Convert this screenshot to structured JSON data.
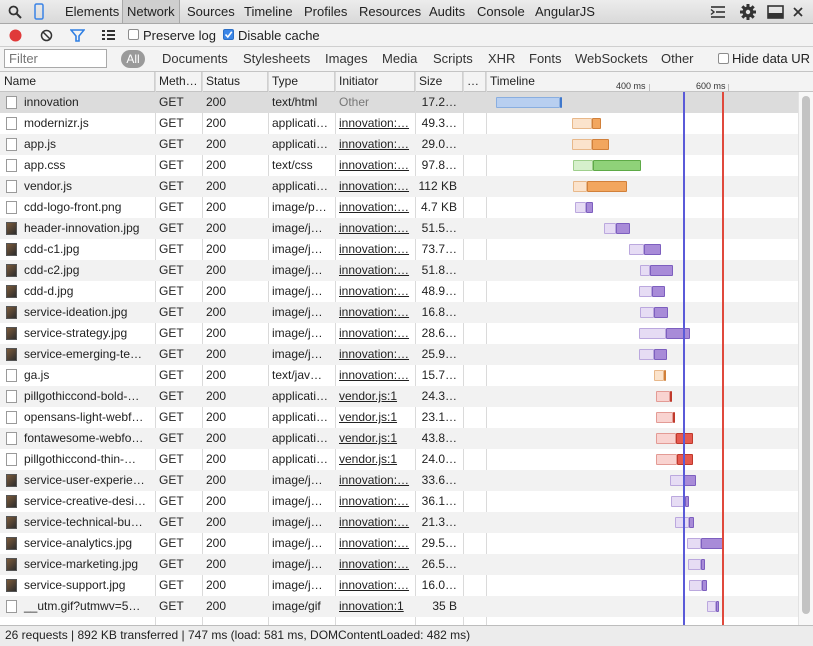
{
  "toolbar": {
    "tabs": [
      "Elements",
      "Network",
      "Sources",
      "Timeline",
      "Profiles",
      "Resources",
      "Audits",
      "Console",
      "AngularJS"
    ],
    "active_tab": "Network"
  },
  "filter": {
    "preserve_log": "Preserve log",
    "disable_cache": "Disable cache",
    "placeholder": "Filter",
    "types": [
      "All",
      "Documents",
      "Stylesheets",
      "Images",
      "Media",
      "Scripts",
      "XHR",
      "Fonts",
      "WebSockets",
      "Other"
    ],
    "hide_data": "Hide data UR"
  },
  "columns": [
    "Name",
    "Meth…",
    "Status",
    "Type",
    "Initiator",
    "Size",
    "…",
    "Timeline"
  ],
  "timeline_ticks": [
    "400 ms",
    "600 ms"
  ],
  "rows": [
    {
      "name": "innovation",
      "method": "GET",
      "status": "200",
      "type": "text/html",
      "initiator": "Other",
      "size": "17.2…",
      "icon": "doc",
      "bars": [
        [
          496,
          560,
          "#b8cff0",
          "#89aee0"
        ],
        [
          560,
          562,
          "#3f78cc",
          "#3f78cc"
        ]
      ]
    },
    {
      "name": "modernizr.js",
      "method": "GET",
      "status": "200",
      "type": "applicati…",
      "initiator": "innovation:…",
      "size": "49.3…",
      "icon": "doc",
      "bars": [
        [
          572,
          592,
          "#fbe3cc",
          "#e8b88a"
        ],
        [
          592,
          601,
          "#f2a65e",
          "#d1803a"
        ]
      ]
    },
    {
      "name": "app.js",
      "method": "GET",
      "status": "200",
      "type": "applicati…",
      "initiator": "innovation:…",
      "size": "29.0…",
      "icon": "doc",
      "bars": [
        [
          572,
          592,
          "#fbe3cc",
          "#e8b88a"
        ],
        [
          592,
          609,
          "#f2a65e",
          "#d1803a"
        ]
      ]
    },
    {
      "name": "app.css",
      "method": "GET",
      "status": "200",
      "type": "text/css",
      "initiator": "innovation:…",
      "size": "97.8…",
      "icon": "doc",
      "bars": [
        [
          573,
          593,
          "#d6f0cc",
          "#9fcf8d"
        ],
        [
          593,
          641,
          "#8fd279",
          "#5eaa47"
        ]
      ]
    },
    {
      "name": "vendor.js",
      "method": "GET",
      "status": "200",
      "type": "applicati…",
      "initiator": "innovation:…",
      "size": "112 KB",
      "icon": "doc",
      "bars": [
        [
          573,
          587,
          "#fbe3cc",
          "#e8b88a"
        ],
        [
          587,
          627,
          "#f2a65e",
          "#d1803a"
        ]
      ]
    },
    {
      "name": "cdd-logo-front.png",
      "method": "GET",
      "status": "200",
      "type": "image/p…",
      "initiator": "innovation:…",
      "size": "4.7 KB",
      "icon": "doc",
      "bars": [
        [
          575,
          586,
          "#e6dcf4",
          "#bba8de"
        ],
        [
          586,
          593,
          "#a88bd8",
          "#7d5fbf"
        ]
      ]
    },
    {
      "name": "header-innovation.jpg",
      "method": "GET",
      "status": "200",
      "type": "image/j…",
      "initiator": "innovation:…",
      "size": "51.5…",
      "icon": "img",
      "bars": [
        [
          604,
          616,
          "#e6dcf4",
          "#bba8de"
        ],
        [
          616,
          630,
          "#a88bd8",
          "#7d5fbf"
        ]
      ]
    },
    {
      "name": "cdd-c1.jpg",
      "method": "GET",
      "status": "200",
      "type": "image/j…",
      "initiator": "innovation:…",
      "size": "73.7…",
      "icon": "img",
      "bars": [
        [
          629,
          644,
          "#e6dcf4",
          "#bba8de"
        ],
        [
          644,
          661,
          "#a88bd8",
          "#7d5fbf"
        ]
      ]
    },
    {
      "name": "cdd-c2.jpg",
      "method": "GET",
      "status": "200",
      "type": "image/j…",
      "initiator": "innovation:…",
      "size": "51.8…",
      "icon": "img",
      "bars": [
        [
          640,
          650,
          "#e6dcf4",
          "#bba8de"
        ],
        [
          650,
          673,
          "#a88bd8",
          "#7d5fbf"
        ]
      ]
    },
    {
      "name": "cdd-d.jpg",
      "method": "GET",
      "status": "200",
      "type": "image/j…",
      "initiator": "innovation:…",
      "size": "48.9…",
      "icon": "img",
      "bars": [
        [
          639,
          652,
          "#e6dcf4",
          "#bba8de"
        ],
        [
          652,
          665,
          "#a88bd8",
          "#7d5fbf"
        ]
      ]
    },
    {
      "name": "service-ideation.jpg",
      "method": "GET",
      "status": "200",
      "type": "image/j…",
      "initiator": "innovation:…",
      "size": "16.8…",
      "icon": "img",
      "bars": [
        [
          640,
          654,
          "#e6dcf4",
          "#bba8de"
        ],
        [
          654,
          668,
          "#a88bd8",
          "#7d5fbf"
        ]
      ]
    },
    {
      "name": "service-strategy.jpg",
      "method": "GET",
      "status": "200",
      "type": "image/j…",
      "initiator": "innovation:…",
      "size": "28.6…",
      "icon": "img",
      "bars": [
        [
          639,
          666,
          "#e6dcf4",
          "#bba8de"
        ],
        [
          666,
          690,
          "#a88bd8",
          "#7d5fbf"
        ]
      ]
    },
    {
      "name": "service-emerging-te…",
      "method": "GET",
      "status": "200",
      "type": "image/j…",
      "initiator": "innovation:…",
      "size": "25.9…",
      "icon": "img",
      "bars": [
        [
          639,
          654,
          "#e6dcf4",
          "#bba8de"
        ],
        [
          654,
          667,
          "#a88bd8",
          "#7d5fbf"
        ]
      ]
    },
    {
      "name": "ga.js",
      "method": "GET",
      "status": "200",
      "type": "text/jav…",
      "initiator": "innovation:…",
      "size": "15.7…",
      "icon": "doc",
      "bars": [
        [
          654,
          664,
          "#fbe3cc",
          "#e8b88a"
        ],
        [
          664,
          666,
          "#f2a65e",
          "#d1803a"
        ]
      ]
    },
    {
      "name": "pillgothiccond-bold-…",
      "method": "GET",
      "status": "200",
      "type": "applicati…",
      "initiator": "vendor.js:1",
      "size": "24.3…",
      "icon": "doc",
      "bars": [
        [
          656,
          670,
          "#f9d3d0",
          "#e39b95"
        ],
        [
          670,
          672,
          "#e55a50",
          "#c0392b"
        ]
      ]
    },
    {
      "name": "opensans-light-webf…",
      "method": "GET",
      "status": "200",
      "type": "applicati…",
      "initiator": "vendor.js:1",
      "size": "23.1…",
      "icon": "doc",
      "bars": [
        [
          656,
          673,
          "#f9d3d0",
          "#e39b95"
        ],
        [
          673,
          675,
          "#e55a50",
          "#c0392b"
        ]
      ]
    },
    {
      "name": "fontawesome-webfo…",
      "method": "GET",
      "status": "200",
      "type": "applicati…",
      "initiator": "vendor.js:1",
      "size": "43.8…",
      "icon": "doc",
      "bars": [
        [
          656,
          676,
          "#f9d3d0",
          "#e39b95"
        ],
        [
          676,
          693,
          "#e55a50",
          "#c0392b"
        ]
      ]
    },
    {
      "name": "pillgothiccond-thin-…",
      "method": "GET",
      "status": "200",
      "type": "applicati…",
      "initiator": "vendor.js:1",
      "size": "24.0…",
      "icon": "doc",
      "bars": [
        [
          656,
          677,
          "#f9d3d0",
          "#e39b95"
        ],
        [
          677,
          693,
          "#e55a50",
          "#c0392b"
        ]
      ]
    },
    {
      "name": "service-user-experie…",
      "method": "GET",
      "status": "200",
      "type": "image/j…",
      "initiator": "innovation:…",
      "size": "33.6…",
      "icon": "img",
      "bars": [
        [
          670,
          684,
          "#e6dcf4",
          "#bba8de"
        ],
        [
          684,
          696,
          "#a88bd8",
          "#7d5fbf"
        ]
      ]
    },
    {
      "name": "service-creative-desi…",
      "method": "GET",
      "status": "200",
      "type": "image/j…",
      "initiator": "innovation:…",
      "size": "36.1…",
      "icon": "img",
      "bars": [
        [
          671,
          685,
          "#e6dcf4",
          "#bba8de"
        ],
        [
          685,
          689,
          "#a88bd8",
          "#7d5fbf"
        ]
      ]
    },
    {
      "name": "service-technical-bu…",
      "method": "GET",
      "status": "200",
      "type": "image/j…",
      "initiator": "innovation:…",
      "size": "21.3…",
      "icon": "img",
      "bars": [
        [
          675,
          689,
          "#e6dcf4",
          "#bba8de"
        ],
        [
          689,
          694,
          "#a88bd8",
          "#7d5fbf"
        ]
      ]
    },
    {
      "name": "service-analytics.jpg",
      "method": "GET",
      "status": "200",
      "type": "image/j…",
      "initiator": "innovation:…",
      "size": "29.5…",
      "icon": "img",
      "bars": [
        [
          687,
          701,
          "#e6dcf4",
          "#bba8de"
        ],
        [
          701,
          723,
          "#a88bd8",
          "#7d5fbf"
        ]
      ]
    },
    {
      "name": "service-marketing.jpg",
      "method": "GET",
      "status": "200",
      "type": "image/j…",
      "initiator": "innovation:…",
      "size": "26.5…",
      "icon": "img",
      "bars": [
        [
          688,
          701,
          "#e6dcf4",
          "#bba8de"
        ],
        [
          701,
          705,
          "#a88bd8",
          "#7d5fbf"
        ]
      ]
    },
    {
      "name": "service-support.jpg",
      "method": "GET",
      "status": "200",
      "type": "image/j…",
      "initiator": "innovation:…",
      "size": "16.0…",
      "icon": "img",
      "bars": [
        [
          689,
          702,
          "#e6dcf4",
          "#bba8de"
        ],
        [
          702,
          707,
          "#a88bd8",
          "#7d5fbf"
        ]
      ]
    },
    {
      "name": "__utm.gif?utmwv=5…",
      "method": "GET",
      "status": "200",
      "type": "image/gif",
      "initiator": "innovation:1",
      "size": "35 B",
      "icon": "doc",
      "bars": [
        [
          707,
          716,
          "#e6dcf4",
          "#bba8de"
        ],
        [
          716,
          719,
          "#a88bd8",
          "#7d5fbf"
        ]
      ]
    }
  ],
  "status_summary": "26 requests | 892 KB transferred | 747 ms (load: 581 ms, DOMContentLoaded: 482 ms)",
  "colors": {
    "dom_content_loaded": "#5a5ad8",
    "load": "#e0493c",
    "record": "#e03a3a",
    "filter_icon": "#2f7fe3"
  },
  "icons": [
    "search-icon",
    "device-icon",
    "record-icon",
    "clear-icon",
    "filter-icon",
    "list-view-icon",
    "console-drawer-icon",
    "gear-icon",
    "dock-icon",
    "close-icon"
  ]
}
